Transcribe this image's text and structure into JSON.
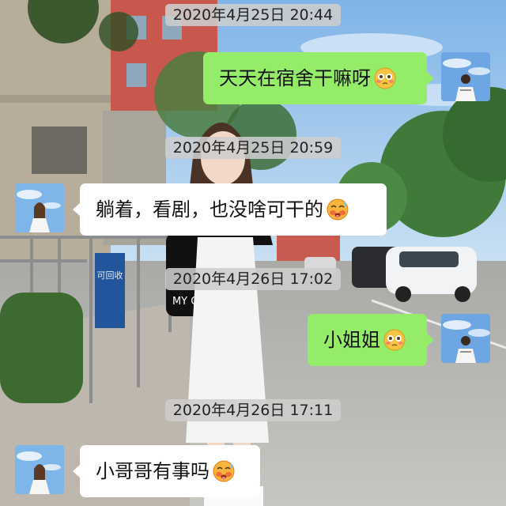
{
  "messages": [
    {
      "timestamp": "2020年4月25日 20:44",
      "sender": "me",
      "text": "天天在宿舍干嘛呀",
      "emoji": "flushed-face"
    },
    {
      "timestamp": "2020年4月25日 20:59",
      "sender": "other",
      "text": "躺着，看剧，也没啥可干的",
      "emoji": "hot-face"
    },
    {
      "timestamp": "2020年4月26日 17:02",
      "sender": "me",
      "text": "小姐姐",
      "emoji": "flushed-face"
    },
    {
      "timestamp": "2020年4月26日 17:11",
      "sender": "other",
      "text": "小哥哥有事吗",
      "emoji": "hot-face"
    }
  ],
  "background": {
    "bag_print": "MY OWN",
    "bin_print": "可回收"
  },
  "colors": {
    "my_bubble": "#95ec69",
    "other_bubble": "#ffffff",
    "timestamp_chip": "#cdcdcd"
  }
}
